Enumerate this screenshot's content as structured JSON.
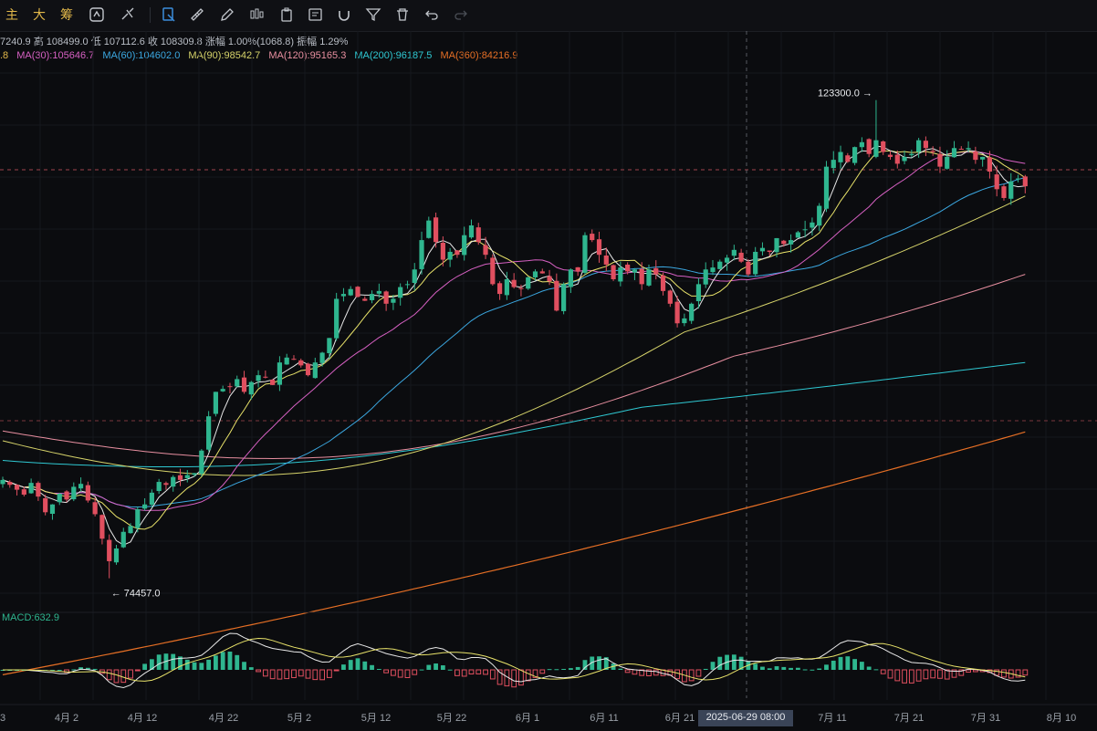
{
  "toolbar": {
    "modes": [
      "主",
      "大",
      "筹"
    ],
    "icons": [
      "replay-icon",
      "indicator-icon",
      "select-icon",
      "ruler-icon",
      "pencil-icon",
      "candle-type-icon",
      "template-icon",
      "note-icon",
      "magnet-icon",
      "filter-icon",
      "trash-icon",
      "undo-icon",
      "redo-icon"
    ]
  },
  "info": {
    "ohlc_text": "7240.9 高 108499.0 低 107112.6 收 108309.8 涨幅 1.00%(1068.8) 振幅 1.29%",
    "ma_truncated": ".8",
    "ma": [
      {
        "label": "MA(30):105646.7",
        "color": "#d660c2"
      },
      {
        "label": "MA(60):104602.0",
        "color": "#3ba7e0"
      },
      {
        "label": "MA(90):98542.7",
        "color": "#d6d36a"
      },
      {
        "label": "MA(120):95165.3",
        "color": "#e88fa0"
      },
      {
        "label": "MA(200):96187.5",
        "color": "#2fc8d2"
      },
      {
        "label": "MA(360):84216.9",
        "color": "#e66f25"
      }
    ]
  },
  "macd": {
    "label": "MACD:632.9"
  },
  "crosshair": {
    "time": "2025-06-29 08:00"
  },
  "colors": {
    "up": "#2fb68f",
    "down": "#e04f5f",
    "background": "#0b0c0f"
  },
  "chart_data": {
    "type": "candlestick",
    "high_label": "123300.0",
    "low_label": "74457.0",
    "x_ticks": [
      "3",
      "4月 2",
      "4月 12",
      "4月 22",
      "5月 2",
      "5月 12",
      "5月 22",
      "6月 1",
      "6月 11",
      "6月 21",
      "7月 11",
      "7月 21",
      "7月 31",
      "8月 10"
    ],
    "closes": [
      84500,
      84000,
      83500,
      83000,
      84200,
      82800,
      81200,
      82000,
      83100,
      82500,
      83800,
      84100,
      82400,
      81000,
      78500,
      76200,
      77500,
      79200,
      79800,
      81500,
      82000,
      83200,
      84300,
      84000,
      84800,
      84500,
      85000,
      85200,
      87500,
      91000,
      93500,
      93800,
      94000,
      94800,
      93500,
      94500,
      95200,
      95000,
      94200,
      96500,
      97000,
      96800,
      96200,
      95200,
      96500,
      97500,
      99000,
      103000,
      103500,
      104000,
      103200,
      102800,
      103500,
      103800,
      102500,
      103000,
      104200,
      104500,
      106000,
      109000,
      111000,
      108800,
      107000,
      107800,
      107500,
      109500,
      110500,
      108800,
      107500,
      104500,
      103500,
      105000,
      104200,
      104000,
      105200,
      105800,
      105600,
      104800,
      101800,
      104500,
      106000,
      105800,
      109500,
      109000,
      107500,
      106500,
      105000,
      106200,
      105800,
      106000,
      104500,
      106000,
      105500,
      103800,
      102500,
      100500,
      101000,
      102500,
      104500,
      106000,
      106200,
      106800,
      107200,
      108000,
      106800,
      105500,
      107800,
      108200,
      107800,
      109200,
      108600,
      109000,
      109800,
      110100,
      110800,
      112500,
      116500,
      117200,
      118000,
      117000,
      118500,
      119000,
      117800,
      119200,
      118000,
      117500,
      116800,
      117500,
      117800,
      119200,
      118400,
      118000,
      116500,
      117500,
      118400,
      118300,
      118400,
      117200,
      117500,
      116000,
      114200,
      113300,
      115000,
      115300,
      114500
    ],
    "ma_series": [
      "MA(5)",
      "MA(10)",
      "MA(30)",
      "MA(60)",
      "MA(90)",
      "MA(120)",
      "MA(200)",
      "MA(360)"
    ],
    "y_range": [
      72000,
      127000
    ]
  }
}
